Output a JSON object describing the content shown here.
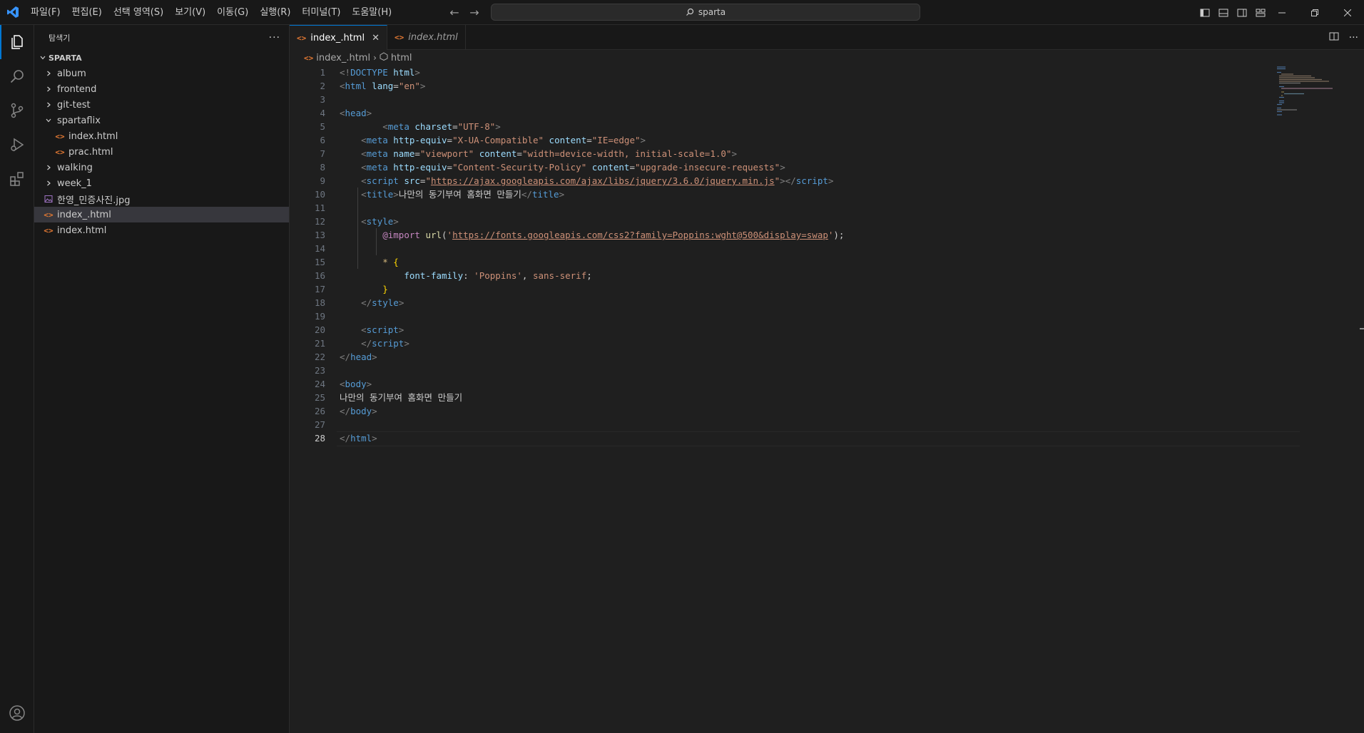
{
  "titlebar": {
    "menu": [
      "파일(F)",
      "편집(E)",
      "선택 영역(S)",
      "보기(V)",
      "이동(G)",
      "실행(R)",
      "터미널(T)",
      "도움말(H)"
    ],
    "search_text": "sparta"
  },
  "sidebar": {
    "title": "탐색기",
    "more": "···",
    "workspace": "SPARTA",
    "tree": [
      {
        "label": "album",
        "type": "folder",
        "expanded": false,
        "depth": 0
      },
      {
        "label": "frontend",
        "type": "folder",
        "expanded": false,
        "depth": 0
      },
      {
        "label": "git-test",
        "type": "folder",
        "expanded": false,
        "depth": 0
      },
      {
        "label": "spartaflix",
        "type": "folder",
        "expanded": true,
        "depth": 0
      },
      {
        "label": "index.html",
        "type": "html",
        "depth": 1
      },
      {
        "label": "prac.html",
        "type": "html",
        "depth": 1
      },
      {
        "label": "walking",
        "type": "folder",
        "expanded": false,
        "depth": 0
      },
      {
        "label": "week_1",
        "type": "folder",
        "expanded": false,
        "depth": 0
      },
      {
        "label": "한영_민증사진.jpg",
        "type": "image",
        "depth": 0
      },
      {
        "label": "index_.html",
        "type": "html",
        "depth": 0,
        "selected": true
      },
      {
        "label": "index.html",
        "type": "html",
        "depth": 0
      }
    ]
  },
  "tabs": [
    {
      "label": "index_.html",
      "active": true,
      "close": "✕"
    },
    {
      "label": "index.html",
      "active": false
    }
  ],
  "breadcrumb": {
    "file": "index_.html",
    "symbol": "html"
  },
  "editor": {
    "current_line": 28,
    "line_count": 28
  },
  "colors": {
    "accent": "#0078d4",
    "html_icon": "#e37933",
    "tag": "#569cd6",
    "attr": "#9cdcfe",
    "string": "#ce9178"
  }
}
